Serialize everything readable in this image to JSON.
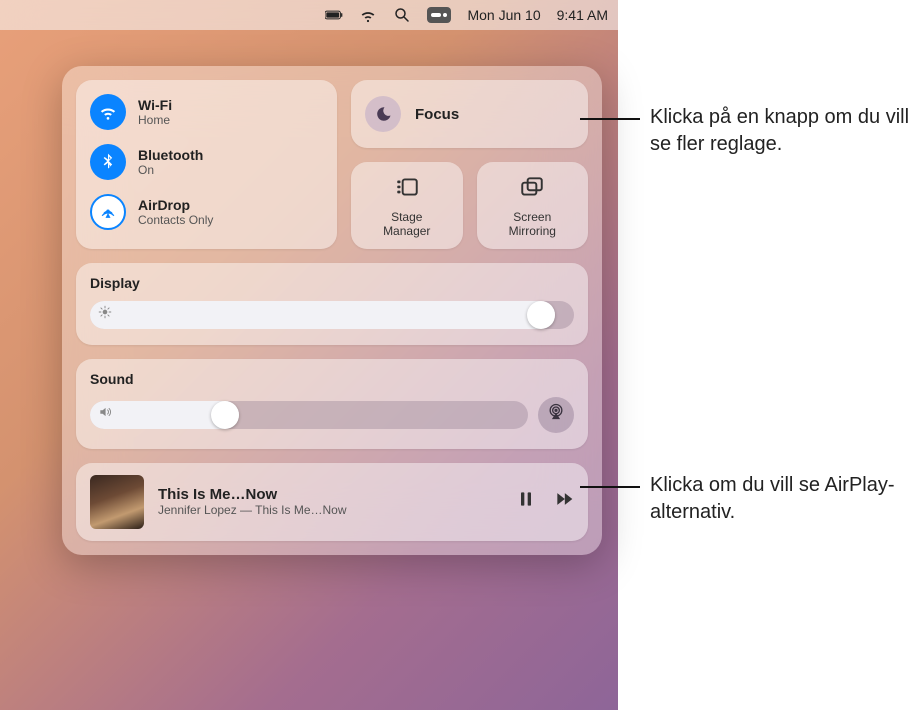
{
  "menubar": {
    "date": "Mon Jun 10",
    "time": "9:41 AM"
  },
  "connectivity": {
    "wifi": {
      "title": "Wi-Fi",
      "sub": "Home"
    },
    "bluetooth": {
      "title": "Bluetooth",
      "sub": "On"
    },
    "airdrop": {
      "title": "AirDrop",
      "sub": "Contacts Only"
    }
  },
  "focus": {
    "label": "Focus"
  },
  "stage_manager": {
    "label": "Stage\nManager",
    "l1": "Stage",
    "l2": "Manager"
  },
  "screen_mirroring": {
    "label": "Screen\nMirroring",
    "l1": "Screen",
    "l2": "Mirroring"
  },
  "display": {
    "title": "Display",
    "value_pct": 96
  },
  "sound": {
    "title": "Sound",
    "value_pct": 34
  },
  "now_playing": {
    "title": "This Is Me…Now",
    "subtitle": "Jennifer Lopez — This Is Me…Now"
  },
  "annotations": {
    "focus_callout": "Klicka på en knapp om du vill se fler reglage.",
    "airplay_callout": "Klicka om du vill se AirPlay-alternativ."
  }
}
